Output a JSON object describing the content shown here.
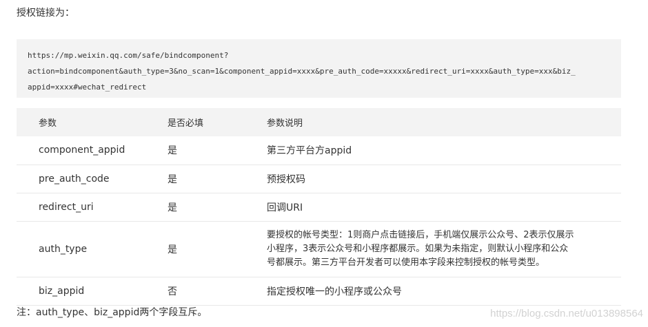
{
  "heading": "授权链接为：",
  "code_lines": [
    "https://mp.weixin.qq.com/safe/bindcomponent?",
    "action=bindcomponent&auth_type=3&no_scan=1&component_appid=xxxx&pre_auth_code=xxxxx&redirect_uri=xxxx&auth_type=xxx&biz_",
    "appid=xxxx#wechat_redirect"
  ],
  "table": {
    "headers": [
      "参数",
      "是否必填",
      "参数说明"
    ],
    "rows": [
      {
        "param": "component_appid",
        "required": "是",
        "desc": "第三方平台方appid"
      },
      {
        "param": "pre_auth_code",
        "required": "是",
        "desc": "预授权码"
      },
      {
        "param": "redirect_uri",
        "required": "是",
        "desc": "回调URI"
      },
      {
        "param": "auth_type",
        "required": "是",
        "desc_lines": [
          "要授权的帐号类型：1则商户点击链接后，手机端仅展示公众号、2表示仅展示",
          "小程序，3表示公众号和小程序都展示。如果为未指定，则默认小程序和公众",
          "号都展示。第三方平台开发者可以使用本字段来控制授权的帐号类型。"
        ]
      },
      {
        "param": "biz_appid",
        "required": "否",
        "desc": "指定授权唯一的小程序或公众号"
      }
    ]
  },
  "note": "注：auth_type、biz_appid两个字段互斥。",
  "watermark": "https://blog.csdn.net/u013898564"
}
